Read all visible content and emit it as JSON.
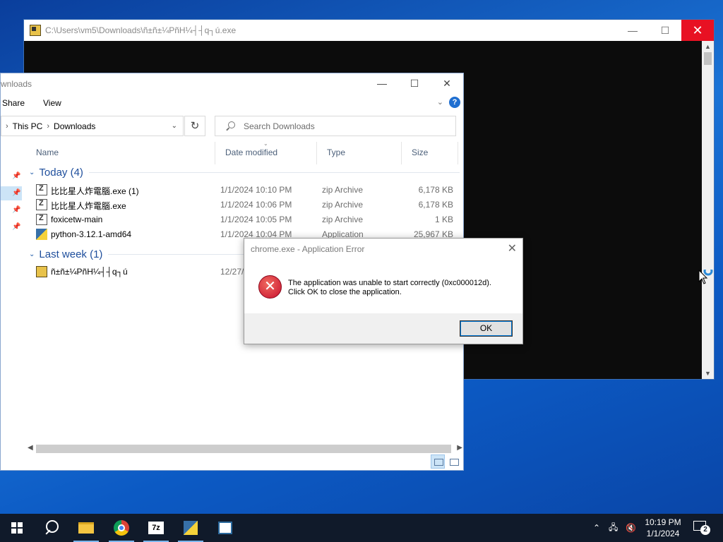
{
  "console": {
    "title": "C:\\Users\\vm5\\Downloads\\ñ±ñ±¼PñH¼┤┤q┐ú.exe"
  },
  "explorer": {
    "title": "wnloads",
    "ribbon": {
      "share": "Share",
      "view": "View"
    },
    "breadcrumb": [
      "This PC",
      "Downloads"
    ],
    "search_placeholder": "Search Downloads",
    "columns": {
      "name": "Name",
      "date": "Date modified",
      "type": "Type",
      "size": "Size"
    },
    "groups": [
      {
        "label": "Today (4)",
        "files": [
          {
            "name": "比比星人炸電腦.exe (1)",
            "date": "1/1/2024 10:10 PM",
            "type": "zip Archive",
            "size": "6,178 KB",
            "icon": "zip-file-icon"
          },
          {
            "name": "比比星人炸電腦.exe",
            "date": "1/1/2024 10:06 PM",
            "type": "zip Archive",
            "size": "6,178 KB",
            "icon": "zip-file-icon"
          },
          {
            "name": "foxicetw-main",
            "date": "1/1/2024 10:05 PM",
            "type": "zip Archive",
            "size": "1 KB",
            "icon": "zip-file-icon"
          },
          {
            "name": "python-3.12.1-amd64",
            "date": "1/1/2024 10:04 PM",
            "type": "Application",
            "size": "25,967 KB",
            "icon": "python-installer-icon"
          }
        ]
      },
      {
        "label": "Last week (1)",
        "files": [
          {
            "name": "ñ±ñ±¼PñH¼┤┤q┐ú",
            "date": "12/27/",
            "type": "",
            "size": "",
            "icon": "application-icon"
          }
        ]
      }
    ]
  },
  "dialog": {
    "title": "chrome.exe - Application Error",
    "message_line1": "The application was unable to start correctly (0xc000012d).",
    "message_line2": "Click OK to close the application.",
    "ok_label": "OK"
  },
  "taskbar": {
    "apps": [
      "start",
      "search",
      "file-explorer",
      "chrome",
      "7-zip",
      "python-app",
      "registry-app"
    ],
    "time": "10:19 PM",
    "date": "1/1/2024",
    "notification_count": "2"
  },
  "colors": {
    "close_red": "#e81123",
    "accent_blue": "#0078d7",
    "taskbar": "#101a2a"
  }
}
